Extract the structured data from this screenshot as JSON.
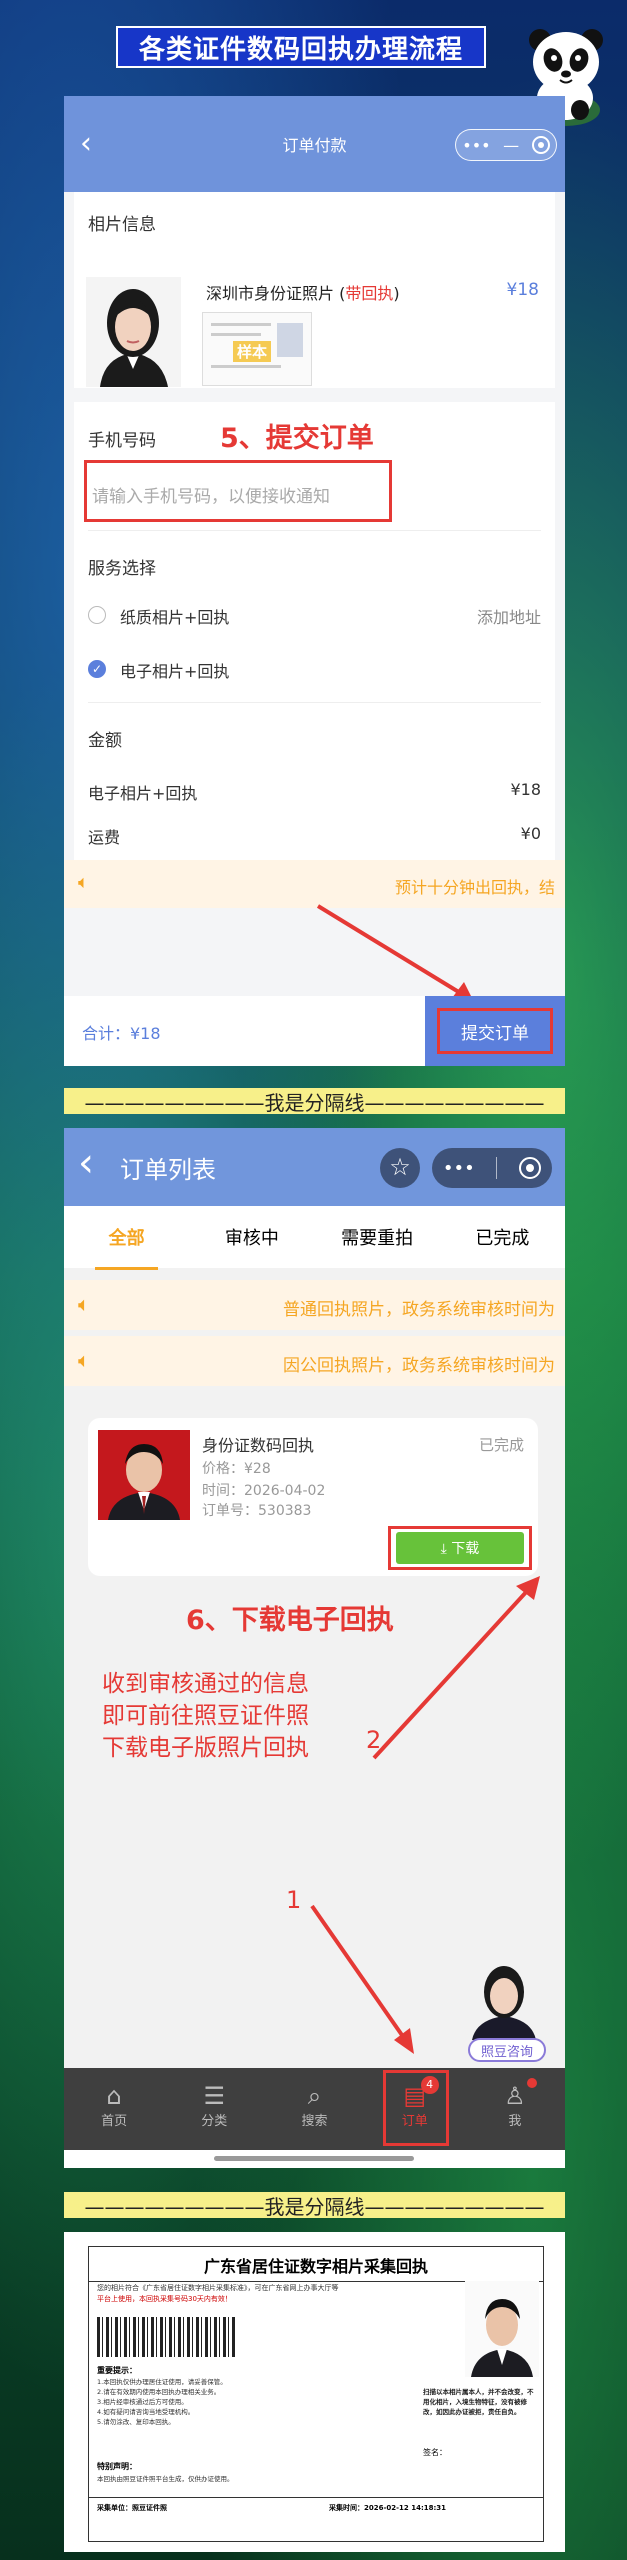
{
  "title": "各类证件数码回执办理流程",
  "payment": {
    "back": "‹",
    "title": "订单付款",
    "capsule_more": "•••",
    "capsule_min": "—",
    "photo_info_label": "相片信息",
    "product_name": "深圳市身份证照片",
    "product_tag": "带回执",
    "product_name_open": " (",
    "product_name_close": ")",
    "price": "¥18",
    "watermark": "样本",
    "phone_label": "手机号码",
    "step5": "5、提交订单",
    "phone_placeholder": "请输入手机号码，以便接收通知",
    "service_label": "服务选择",
    "option1": "纸质相片+回执",
    "add_address": "添加地址",
    "option2": "电子相片+回执",
    "amount_label": "金额",
    "line1_label": "电子相片+回执",
    "line1_value": "¥18",
    "line2_label": "运费",
    "line2_value": "¥0",
    "notice": "预计十分钟出回执，结",
    "total": "合计：¥18",
    "submit": "提交订单"
  },
  "divider": "—————————我是分隔线—————————",
  "orders": {
    "back": "‹",
    "title": "订单列表",
    "capsule_more": "•••",
    "tabs": [
      "全部",
      "审核中",
      "需要重拍",
      "已完成"
    ],
    "notice1": "普通回执照片，政务系统审核时间为",
    "notice2": "因公回执照片，政务系统审核时间为",
    "item_title": "身份证数码回执",
    "item_status": "已完成",
    "item_price": "价格：¥28",
    "item_time": "时间：2026-04-02",
    "item_no": "订单号：530383",
    "download": "⤓ 下载",
    "step6": "6、下载电子回执",
    "hint": [
      "收到审核通过的信息",
      "即可前往照豆证件照",
      "下载电子版照片回执"
    ],
    "num1": "1",
    "num2": "2",
    "consult": "照豆咨询",
    "tabbar": [
      {
        "icon": "⌂",
        "label": "首页"
      },
      {
        "icon": "☰",
        "label": "分类"
      },
      {
        "icon": "⌕",
        "label": "搜索"
      },
      {
        "icon": "▤",
        "label": "订单"
      },
      {
        "icon": "♙",
        "label": "我"
      }
    ],
    "order_badge": "4"
  },
  "receipt": {
    "title": "广东省居住证数字相片采集回执",
    "intro1": "您的相片符合《广东省居住证数字相片采集标准》，可在广东省网上办事大厅等",
    "intro2": "平台上使用，本回执采集号码30天内有效！",
    "notes_title": "重要提示：",
    "notes": [
      "1.本回执仅供办理居住证使用，请妥善保管。",
      "2.请在有效期内使用本回执办理相关业务。",
      "3.相片经审核通过后方可使用。",
      "4.如有疑问请咨询当地受理机构。",
      "5.请勿涂改、复印本回执。"
    ],
    "special_title": "特别声明：",
    "special": "本回执由照豆证件照平台生成，仅供办证使用。",
    "right_note": "扫描以本相片属本人，并不会改变，不用化相片，入境生物特征，没有被修改，如因此办证被拒，责任自负。",
    "sign": "签名：",
    "footer_left": "采集单位：照豆证件照",
    "footer_right": "采集时间：2026-02-12 14:18:31"
  }
}
